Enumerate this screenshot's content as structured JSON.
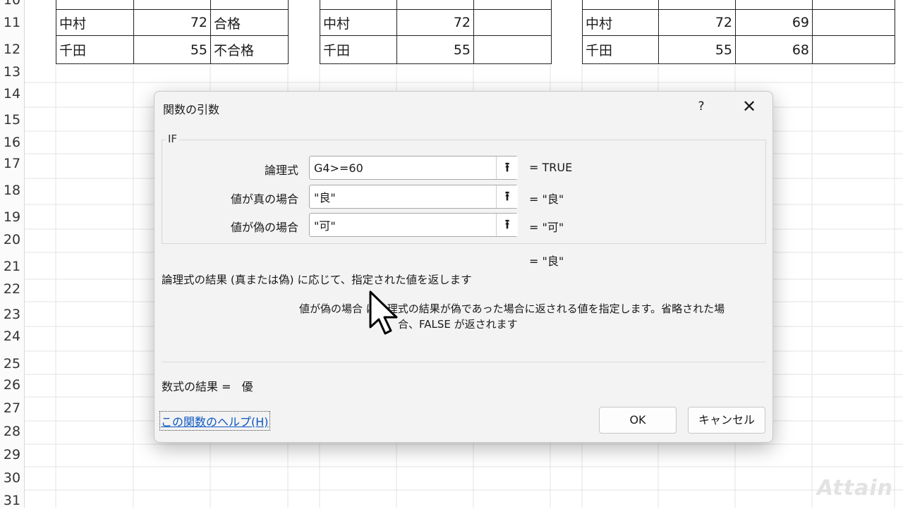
{
  "sheet": {
    "row_numbers": [
      "10",
      "11",
      "12",
      "13",
      "14",
      "15",
      "16",
      "17",
      "18",
      "19",
      "20",
      "21",
      "22",
      "23",
      "24",
      "25",
      "26",
      "27",
      "28",
      "29",
      "30",
      "31"
    ],
    "table1": [
      [
        "中村",
        "72",
        "合格"
      ],
      [
        "千田",
        "55",
        "不合格"
      ]
    ],
    "table2": [
      [
        "中村",
        "72",
        ""
      ],
      [
        "千田",
        "55",
        ""
      ]
    ],
    "table3": [
      [
        "中村",
        "72",
        "69",
        ""
      ],
      [
        "千田",
        "55",
        "68",
        ""
      ]
    ],
    "watermark": "Attain"
  },
  "dialog": {
    "title": "関数の引数",
    "help_glyph": "?",
    "close_glyph": "✕",
    "function_name": "IF",
    "args": [
      {
        "label": "論理式",
        "value": "G4>=60",
        "result": "=  TRUE"
      },
      {
        "label": "値が真の場合",
        "value": "\"良\"",
        "result": "=  \"良\""
      },
      {
        "label": "値が偽の場合",
        "value": "\"可\"",
        "result": "=  \"可\""
      }
    ],
    "ref_button_glyph": "⭱",
    "overall_result": "=  \"良\"",
    "description": "論理式の結果 (真または偽) に応じて、指定された値を返します",
    "arg_description_line1": "値が偽の場合 は論理式の結果が偽であった場合に返される値を指定します。省略された場",
    "arg_description_line2": "合、FALSE が返されます",
    "formula_result_label": "数式の結果 =",
    "formula_result_value": "優",
    "help_link": "この関数のヘルプ(H)",
    "ok_label": "OK",
    "cancel_label": "キャンセル"
  }
}
